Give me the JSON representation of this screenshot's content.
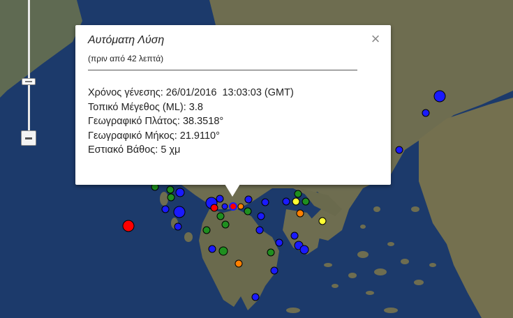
{
  "map": {
    "colors": {
      "sea": "#1c3a6b",
      "land": "#6b6b4e",
      "marker_blue": "#1a1aff",
      "marker_green": "#1f8f1f",
      "marker_red": "#ff0000",
      "marker_orange": "#ff8000",
      "marker_yellow": "#ffff33"
    },
    "zoom": {
      "handle_icon": "zoom-slider-handle",
      "zoom_out_icon": "minus-icon"
    }
  },
  "popup": {
    "title": "Αυτόματη Λύση",
    "subtitle": "(πριν από 42 λεπτά)",
    "close_glyph": "×",
    "rows": [
      {
        "label": "Χρόνος γένεσης:",
        "value": " 26/01/2016  13:03:03 (GMT)"
      },
      {
        "label": "Τοπικό Μέγεθος (ML):",
        "value": " 3.8"
      },
      {
        "label": "Γεωγραφικό Πλάτος:",
        "value": " 38.3518°"
      },
      {
        "label": "Γεωγραφικό Μήκος:",
        "value": " 21.9110°"
      },
      {
        "label": "Εστιακό Βάθος:",
        "value": " 5 χμ"
      }
    ]
  }
}
